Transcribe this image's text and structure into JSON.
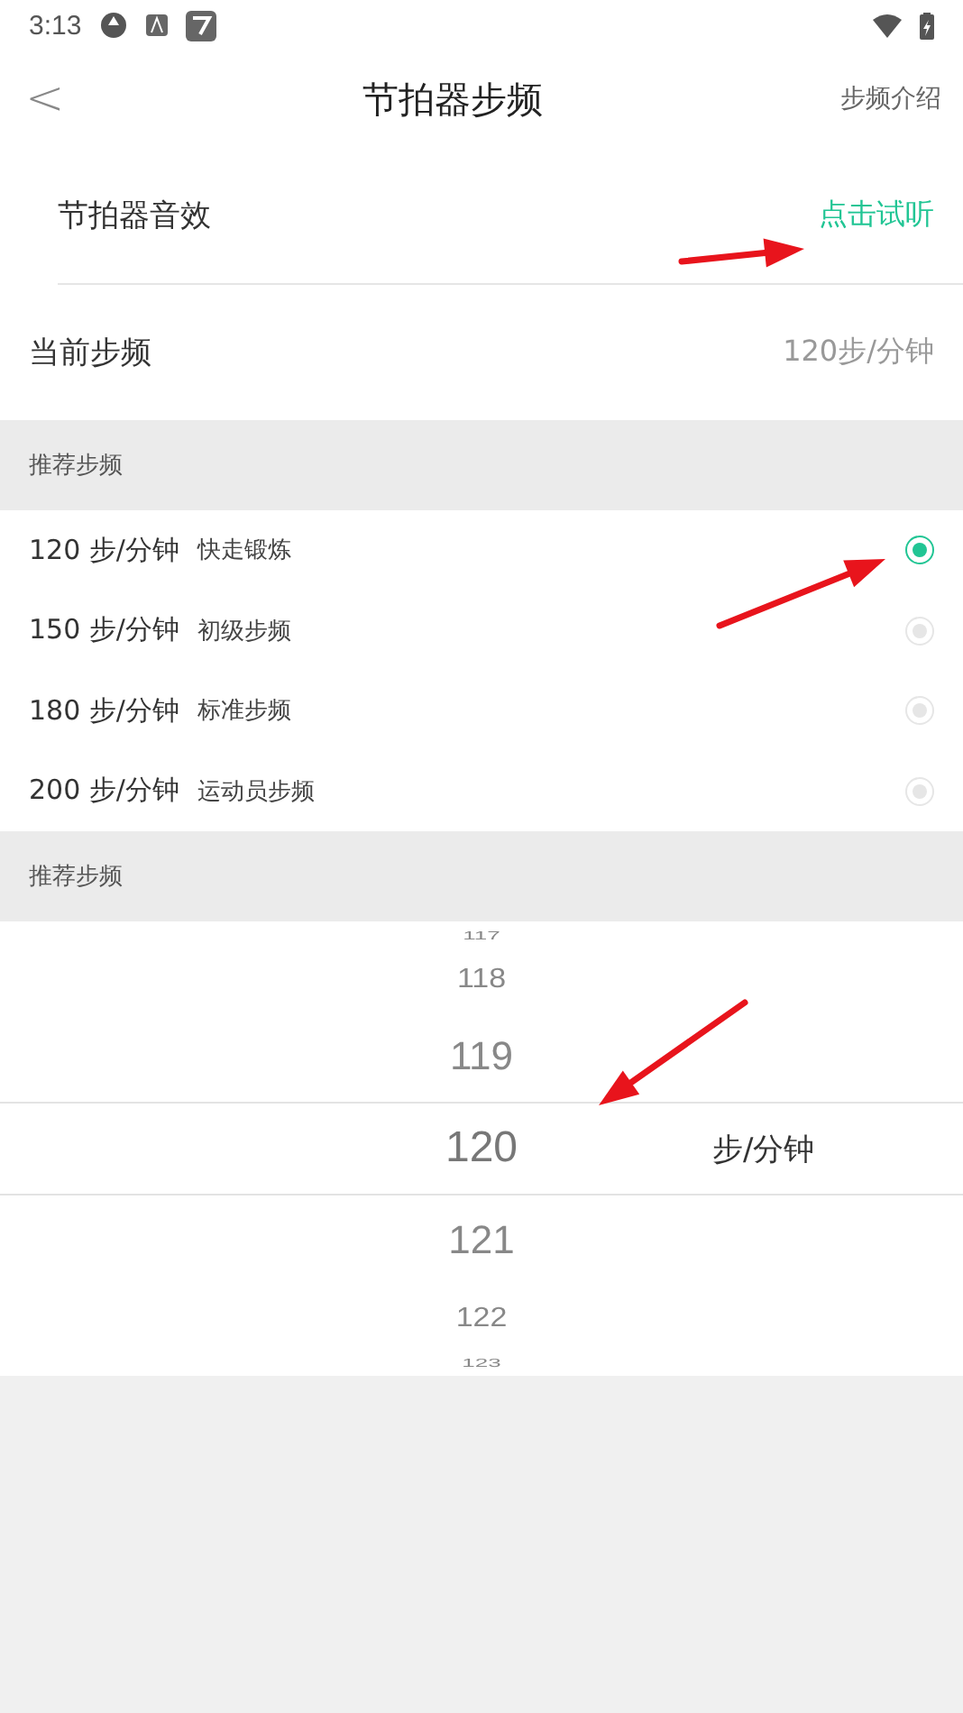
{
  "status_bar": {
    "time": "3:13"
  },
  "header": {
    "back": "<",
    "title": "节拍器步频",
    "action": "步频介绍"
  },
  "settings": [
    {
      "label": "节拍器音效",
      "value": "点击试听",
      "kind": "link"
    },
    {
      "label": "当前步频",
      "value": "120步/分钟",
      "kind": "value"
    }
  ],
  "recommended": {
    "title": "推荐步频",
    "options": [
      {
        "rate": "120 步/分钟",
        "desc": "快走锻炼",
        "selected": true
      },
      {
        "rate": "150 步/分钟",
        "desc": "初级步频",
        "selected": false
      },
      {
        "rate": "180 步/分钟",
        "desc": "标准步频",
        "selected": false
      },
      {
        "rate": "200 步/分钟",
        "desc": "运动员步频",
        "selected": false
      }
    ]
  },
  "picker": {
    "title": "推荐步频",
    "unit": "步/分钟",
    "items": [
      {
        "value": "117",
        "selected": false
      },
      {
        "value": "118",
        "selected": false
      },
      {
        "value": "119",
        "selected": false
      },
      {
        "value": "120",
        "selected": true
      },
      {
        "value": "121",
        "selected": false
      },
      {
        "value": "122",
        "selected": false
      },
      {
        "value": "123",
        "selected": false
      }
    ]
  }
}
